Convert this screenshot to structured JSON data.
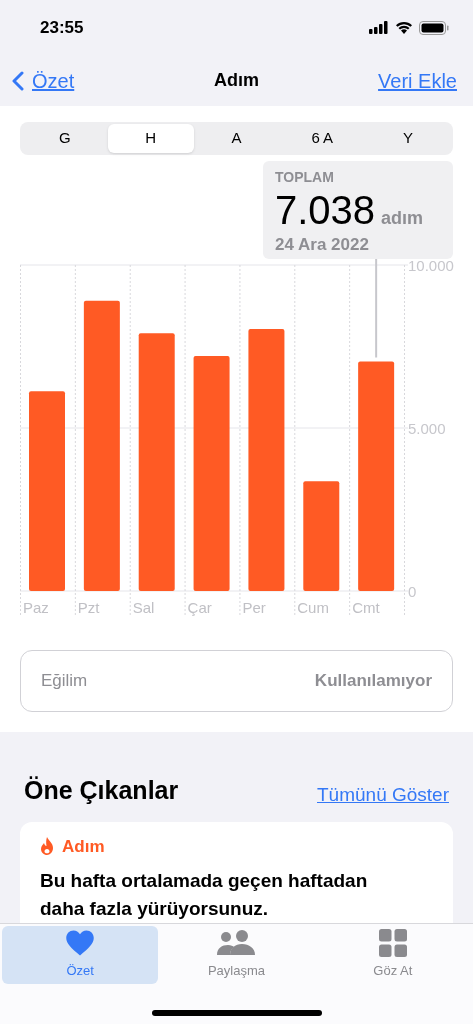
{
  "status_bar": {
    "time": "23:55"
  },
  "nav": {
    "back": "Özet",
    "title": "Adım",
    "action": "Veri Ekle"
  },
  "segments": [
    {
      "label": "G",
      "selected": false
    },
    {
      "label": "H",
      "selected": true
    },
    {
      "label": "A",
      "selected": false
    },
    {
      "label": "6 A",
      "selected": false
    },
    {
      "label": "Y",
      "selected": false
    }
  ],
  "callout": {
    "label": "TOPLAM",
    "value": "7.038",
    "unit": "adım",
    "date": "24 Ara 2022"
  },
  "chart": {
    "chart_data": {
      "type": "bar",
      "categories": [
        "Paz",
        "Pzt",
        "Sal",
        "Çar",
        "Per",
        "Cum",
        "Cmt"
      ],
      "series": [
        {
          "color": "#ff5a24",
          "values": [
            6130,
            8900,
            7910,
            7210,
            8040,
            3370,
            7040
          ]
        }
      ],
      "ylim": [
        0,
        10000
      ],
      "yticks": [
        {
          "value": 0,
          "label": "0"
        },
        {
          "value": 5000,
          "label": "5.000"
        },
        {
          "value": 10000,
          "label": "10.000"
        }
      ]
    },
    "bars": [
      {
        "selected": false
      },
      {
        "selected": false
      },
      {
        "selected": false
      },
      {
        "selected": false
      },
      {
        "selected": false
      },
      {
        "selected": false
      },
      {
        "selected": true
      }
    ]
  },
  "trend": {
    "label": "Eğilim",
    "value": "Kullanılamıyor"
  },
  "highlights": {
    "title": "Öne Çıkanlar",
    "link": "Tümünü Göster",
    "card": {
      "category": "Adım",
      "text": "Bu hafta ortalamada geçen haftadan daha fazla yürüyorsunuz."
    }
  },
  "tab_bar": [
    {
      "label": "Özet",
      "kind": "heart",
      "selected": true
    },
    {
      "label": "Paylaşma",
      "kind": "people",
      "selected": false
    },
    {
      "label": "Göz At",
      "kind": "grid",
      "selected": false
    }
  ]
}
